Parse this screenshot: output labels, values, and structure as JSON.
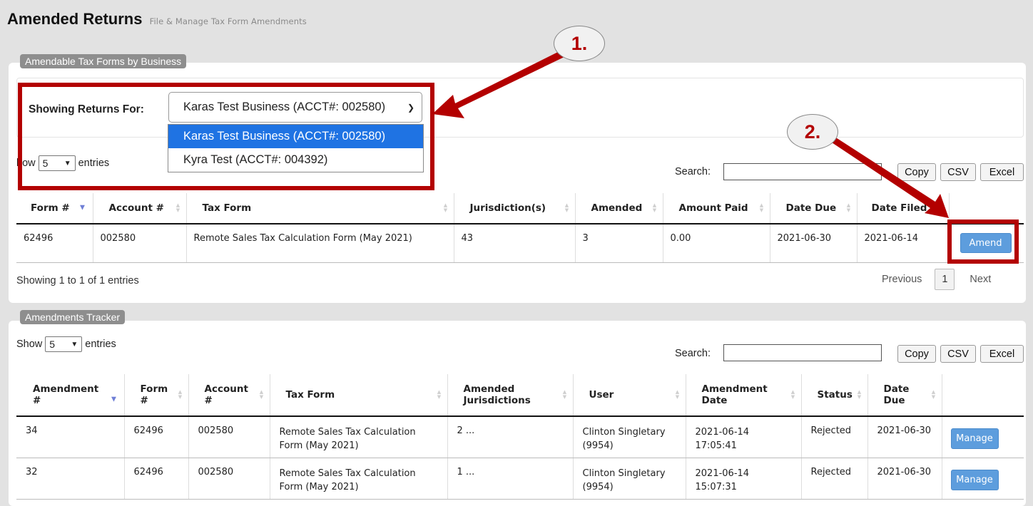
{
  "header": {
    "title": "Amended Returns",
    "subtitle": "File & Manage Tax Form Amendments"
  },
  "amendable": {
    "legend": "Amendable Tax Forms by Business",
    "showing_label": "Showing Returns For:",
    "selected_business": "Karas Test Business (ACCT#: 002580)",
    "options": [
      "Karas Test Business (ACCT#: 002580)",
      "Kyra Test (ACCT#: 004392)"
    ],
    "show_prefix": "how",
    "show_count": "5",
    "show_suffix": "entries",
    "search_label": "Search:",
    "export_buttons": [
      "Copy",
      "CSV",
      "Excel"
    ],
    "columns": [
      "Form #",
      "Account #",
      "Tax Form",
      "Jurisdiction(s)",
      "Amended",
      "Amount Paid",
      "Date Due",
      "Date Filed"
    ],
    "rows": [
      {
        "form": "62496",
        "account": "002580",
        "tax_form": "Remote Sales Tax Calculation Form (May 2021)",
        "jurisdictions": "43",
        "amended": "3",
        "amount_paid": "0.00",
        "date_due": "2021-06-30",
        "date_filed": "2021-06-14",
        "action": "Amend"
      }
    ],
    "info": "Showing 1 to 1 of 1 entries",
    "pager": {
      "previous": "Previous",
      "page": "1",
      "next": "Next"
    }
  },
  "tracker": {
    "legend": "Amendments Tracker",
    "show_prefix": "Show",
    "show_count": "5",
    "show_suffix": "entries",
    "search_label": "Search:",
    "export_buttons": [
      "Copy",
      "CSV",
      "Excel"
    ],
    "columns": [
      {
        "line1": "Amendment",
        "line2": "#"
      },
      {
        "line1": "Form",
        "line2": "#"
      },
      {
        "line1": "Account",
        "line2": "#"
      },
      {
        "line1": "Tax Form",
        "line2": ""
      },
      {
        "line1": "Amended",
        "line2": "Jurisdictions"
      },
      {
        "line1": "User",
        "line2": ""
      },
      {
        "line1": "Amendment",
        "line2": "Date"
      },
      {
        "line1": "Status",
        "line2": ""
      },
      {
        "line1": "Date",
        "line2": "Due"
      }
    ],
    "rows": [
      {
        "amendment": "34",
        "form": "62496",
        "account": "002580",
        "tax_form_1": "Remote Sales Tax Calculation",
        "tax_form_2": "Form (May 2021)",
        "jurisdictions": "2 ...",
        "user_1": "Clinton Singletary",
        "user_2": "(9954)",
        "date_1": "2021-06-14",
        "date_2": "17:05:41",
        "status": "Rejected",
        "date_due": "2021-06-30",
        "action": "Manage"
      },
      {
        "amendment": "32",
        "form": "62496",
        "account": "002580",
        "tax_form_1": "Remote Sales Tax Calculation",
        "tax_form_2": "Form (May 2021)",
        "jurisdictions": "1 ...",
        "user_1": "Clinton Singletary",
        "user_2": "(9954)",
        "date_1": "2021-06-14",
        "date_2": "15:07:31",
        "status": "Rejected",
        "date_due": "2021-06-30",
        "action": "Manage"
      }
    ]
  },
  "annotations": {
    "step1": "1.",
    "step2": "2.",
    "color": "#b30000"
  }
}
